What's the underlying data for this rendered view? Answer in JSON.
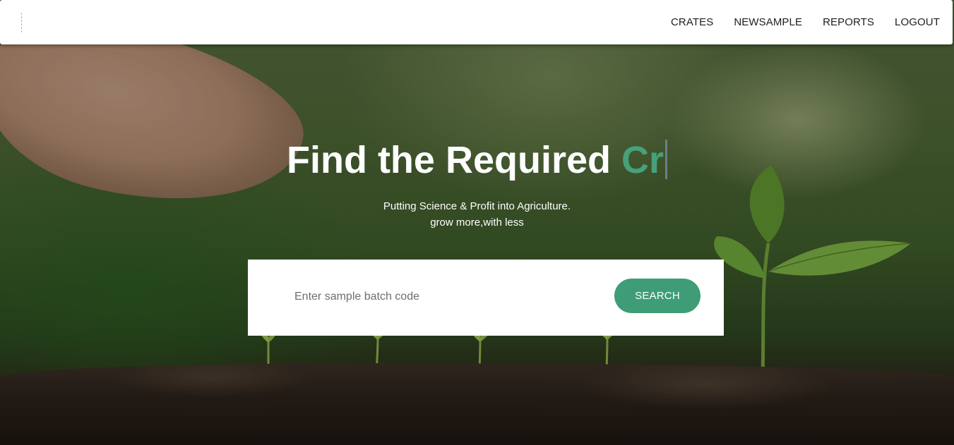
{
  "header": {
    "nav": [
      {
        "label": "CRATES"
      },
      {
        "label": "NEWSAMPLE"
      },
      {
        "label": "REPORTS"
      },
      {
        "label": "LOGOUT"
      }
    ]
  },
  "hero": {
    "headline_static": "Find the Required ",
    "headline_typed": "Cr",
    "tagline_line1": "Putting Science & Profit into Agriculture.",
    "tagline_line2": "grow more,with less"
  },
  "search": {
    "placeholder": "Enter sample batch code",
    "value": "",
    "button_label": "SEARCH"
  },
  "colors": {
    "accent": "#3e9d76",
    "typed_text": "#46a17a",
    "header_bg": "#ffffff"
  }
}
